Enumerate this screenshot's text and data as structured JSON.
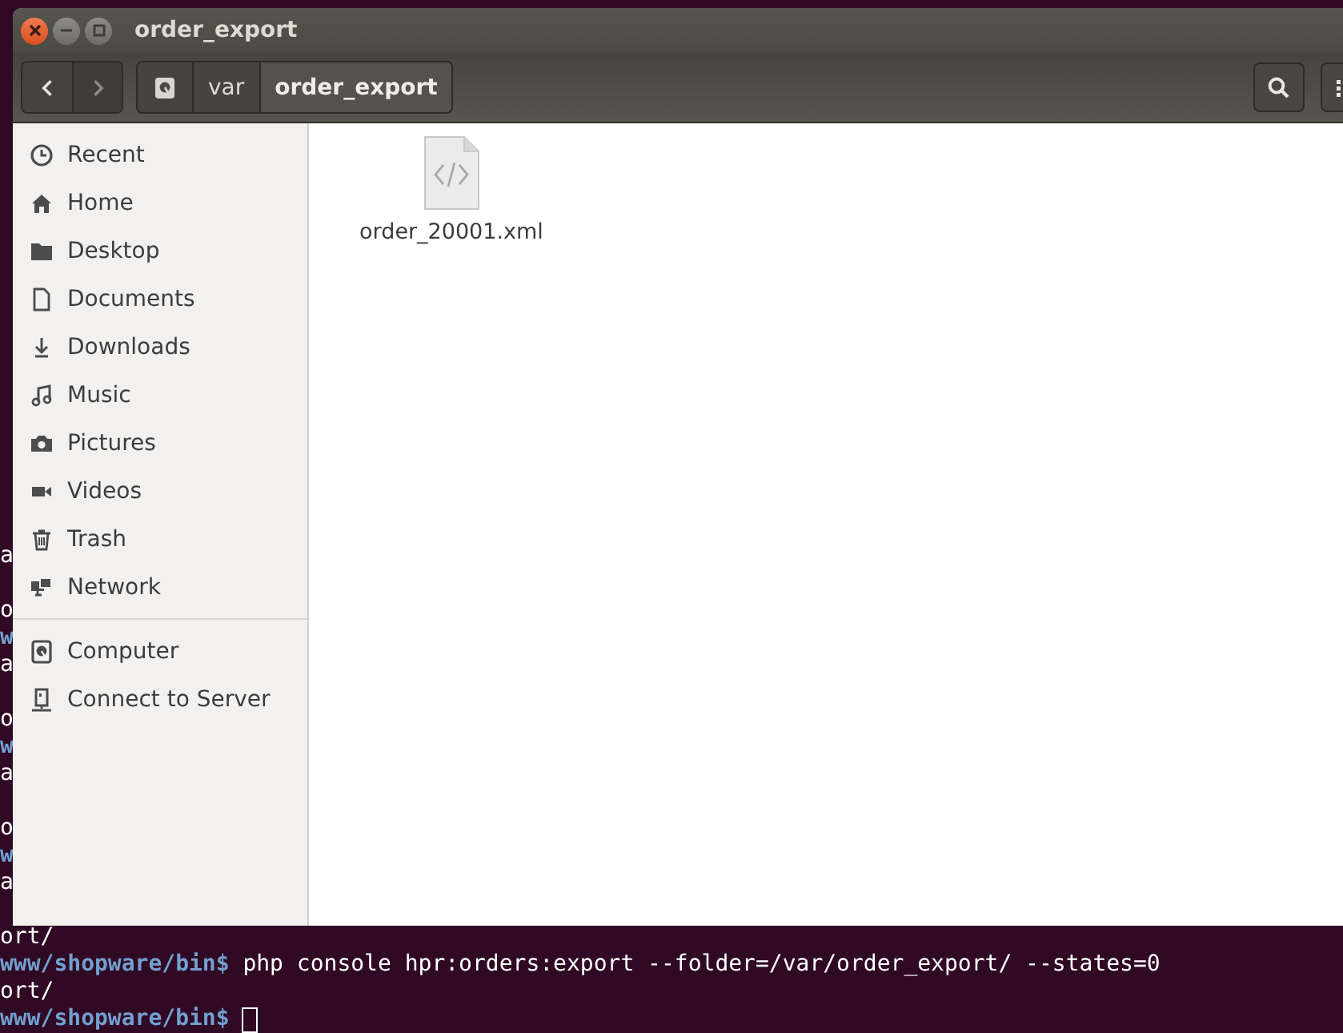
{
  "window": {
    "title": "order_export"
  },
  "toolbar": {
    "nav": [
      {
        "kind": "back",
        "disabled": false
      },
      {
        "kind": "forward",
        "disabled": true
      }
    ],
    "path": [
      {
        "kind": "drive",
        "selected": false
      },
      {
        "kind": "folder",
        "label": "var",
        "selected": false
      },
      {
        "kind": "folder",
        "label": "order_export",
        "selected": true
      }
    ],
    "actions": [
      {
        "kind": "search"
      },
      {
        "kind": "grid"
      }
    ]
  },
  "sidebar": {
    "sections": [
      {
        "items": [
          {
            "kind": "recent",
            "label": "Recent"
          },
          {
            "kind": "home",
            "label": "Home"
          },
          {
            "kind": "folder",
            "label": "Desktop"
          },
          {
            "kind": "document",
            "label": "Documents"
          },
          {
            "kind": "download",
            "label": "Downloads"
          },
          {
            "kind": "music",
            "label": "Music"
          },
          {
            "kind": "camera",
            "label": "Pictures"
          },
          {
            "kind": "video",
            "label": "Videos"
          },
          {
            "kind": "trash",
            "label": "Trash"
          },
          {
            "kind": "network",
            "label": "Network"
          }
        ]
      },
      {
        "items": [
          {
            "kind": "drive",
            "label": "Computer"
          },
          {
            "kind": "server",
            "label": "Connect to Server"
          }
        ]
      }
    ]
  },
  "files": [
    {
      "kind": "xml",
      "name": "order_20001.xml"
    }
  ],
  "terminal": {
    "lines": [
      {
        "kind": "output",
        "text": "a"
      },
      {
        "kind": "blank"
      },
      {
        "kind": "output",
        "text": "o"
      },
      {
        "kind": "prompt",
        "prompt": "w"
      },
      {
        "kind": "output",
        "text": "a"
      },
      {
        "kind": "blank"
      },
      {
        "kind": "output",
        "text": "o"
      },
      {
        "kind": "prompt",
        "prompt": "w"
      },
      {
        "kind": "output",
        "text": "a"
      },
      {
        "kind": "blank"
      },
      {
        "kind": "output",
        "text": "o"
      },
      {
        "kind": "prompt",
        "prompt": "w"
      },
      {
        "kind": "output",
        "text": "a"
      },
      {
        "kind": "blank"
      },
      {
        "kind": "output",
        "text": "ort/"
      },
      {
        "kind": "prompt",
        "prompt": "www/shopware/bin$",
        "command": "php console hpr:orders:export --folder=/var/order_export/ --states=0"
      },
      {
        "kind": "output",
        "text": "ort/"
      },
      {
        "kind": "prompt",
        "prompt": "www/shopware/bin$",
        "cursor": true
      }
    ]
  }
}
